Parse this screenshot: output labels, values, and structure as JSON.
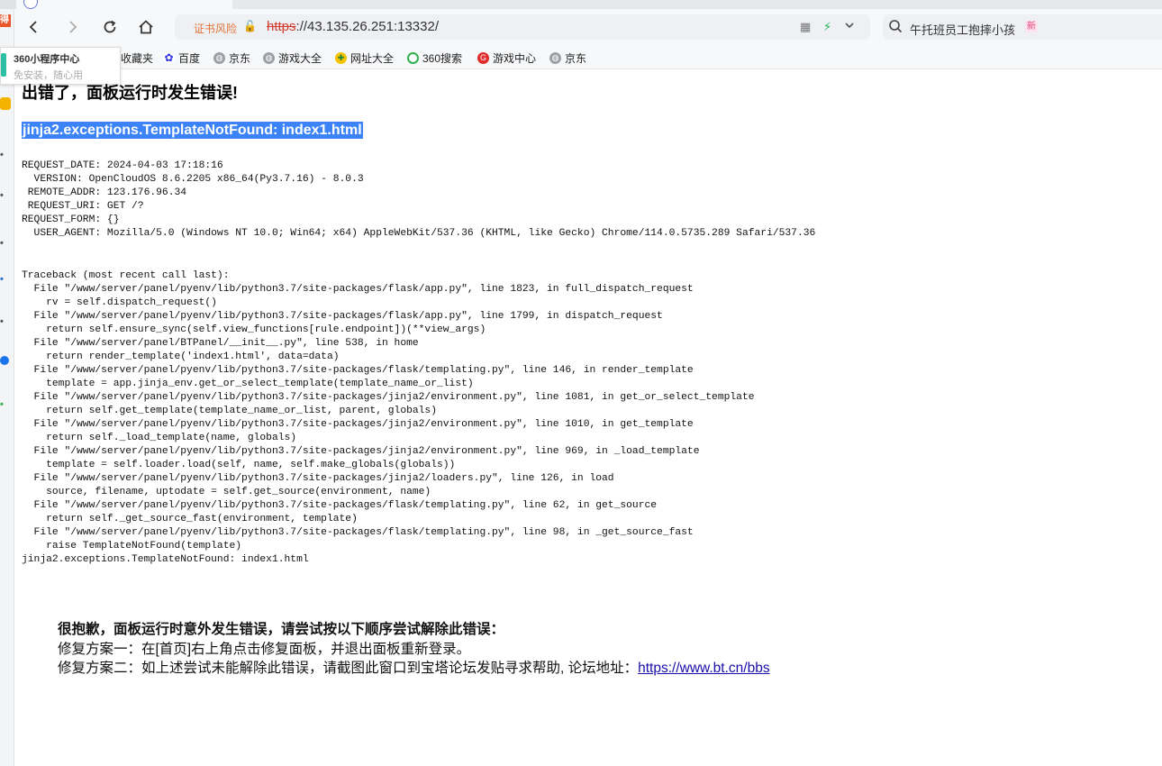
{
  "browser": {
    "cert_warning": "证书风险",
    "url_scheme": "https",
    "url_rest": "://43.135.26.251:13332/",
    "search_text": "午托班员工抱摔小孩",
    "search_badge": "新",
    "bookmarks": [
      {
        "label": "收藏夹",
        "icon": "star-icon"
      },
      {
        "label": "百度",
        "icon": "baidu-icon"
      },
      {
        "label": "京东",
        "icon": "globe-icon"
      },
      {
        "label": "游戏大全",
        "icon": "globe-icon"
      },
      {
        "label": "网址大全",
        "icon": "site-icon"
      },
      {
        "label": "360搜索",
        "icon": "so-icon"
      },
      {
        "label": "游戏中心",
        "icon": "game-icon"
      },
      {
        "label": "京东",
        "icon": "globe-icon"
      }
    ],
    "popup": {
      "title": "360小程序中心",
      "subtitle": "免安装，随心用"
    },
    "side_badge": "得"
  },
  "page": {
    "title": "出错了，面板运行时发生错误!",
    "error_header": "jinja2.exceptions.TemplateNotFound: index1.html",
    "request_info": "REQUEST_DATE: 2024-04-03 17:18:16\n  VERSION: OpenCloudOS 8.6.2205 x86_64(Py3.7.16) - 8.0.3\n REMOTE_ADDR: 123.176.96.34\n REQUEST_URI: GET /?\nREQUEST_FORM: {}\n  USER_AGENT: Mozilla/5.0 (Windows NT 10.0; Win64; x64) AppleWebKit/537.36 (KHTML, like Gecko) Chrome/114.0.5735.289 Safari/537.36",
    "traceback": "Traceback (most recent call last):\n  File \"/www/server/panel/pyenv/lib/python3.7/site-packages/flask/app.py\", line 1823, in full_dispatch_request\n    rv = self.dispatch_request()\n  File \"/www/server/panel/pyenv/lib/python3.7/site-packages/flask/app.py\", line 1799, in dispatch_request\n    return self.ensure_sync(self.view_functions[rule.endpoint])(**view_args)\n  File \"/www/server/panel/BTPanel/__init__.py\", line 538, in home\n    return render_template('index1.html', data=data)\n  File \"/www/server/panel/pyenv/lib/python3.7/site-packages/flask/templating.py\", line 146, in render_template\n    template = app.jinja_env.get_or_select_template(template_name_or_list)\n  File \"/www/server/panel/pyenv/lib/python3.7/site-packages/jinja2/environment.py\", line 1081, in get_or_select_template\n    return self.get_template(template_name_or_list, parent, globals)\n  File \"/www/server/panel/pyenv/lib/python3.7/site-packages/jinja2/environment.py\", line 1010, in get_template\n    return self._load_template(name, globals)\n  File \"/www/server/panel/pyenv/lib/python3.7/site-packages/jinja2/environment.py\", line 969, in _load_template\n    template = self.loader.load(self, name, self.make_globals(globals))\n  File \"/www/server/panel/pyenv/lib/python3.7/site-packages/jinja2/loaders.py\", line 126, in load\n    source, filename, uptodate = self.get_source(environment, name)\n  File \"/www/server/panel/pyenv/lib/python3.7/site-packages/flask/templating.py\", line 62, in get_source\n    return self._get_source_fast(environment, template)\n  File \"/www/server/panel/pyenv/lib/python3.7/site-packages/flask/templating.py\", line 98, in _get_source_fast\n    raise TemplateNotFound(template)\njinja2.exceptions.TemplateNotFound: index1.html",
    "help_title": "很抱歉，面板运行时意外发生错误，请尝试按以下顺序尝试解除此错误：",
    "fix1": "修复方案一：在[首页]右上角点击修复面板，并退出面板重新登录。",
    "fix2": "修复方案二：如上述尝试未能解除此错误，请截图此窗口到宝塔论坛发贴寻求帮助, 论坛地址：",
    "forum_link": "https://www.bt.cn/bbs"
  }
}
